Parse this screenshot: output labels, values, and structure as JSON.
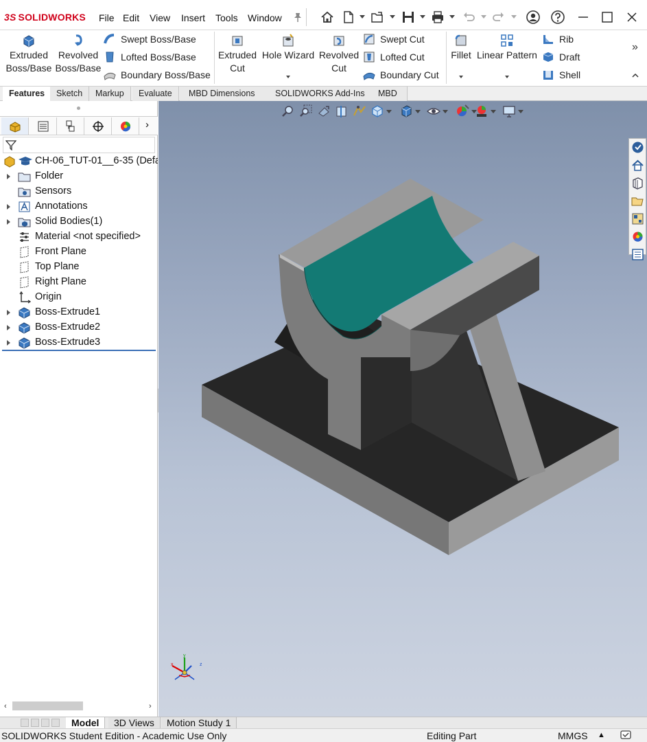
{
  "app": {
    "brand": "SOLIDWORKS",
    "brand_prefix": "3S"
  },
  "menu": [
    "File",
    "Edit",
    "View",
    "Insert",
    "Tools",
    "Window"
  ],
  "window_controls": {
    "minimize": "minimize-icon",
    "maximize": "maximize-icon",
    "close": "close-icon"
  },
  "ribbon": {
    "extruded_boss": [
      "Extruded",
      "Boss/Base"
    ],
    "revolved_boss": [
      "Revolved",
      "Boss/Base"
    ],
    "swept_boss": "Swept Boss/Base",
    "lofted_boss": "Lofted Boss/Base",
    "boundary_boss": "Boundary Boss/Base",
    "extruded_cut": [
      "Extruded",
      "Cut"
    ],
    "hole_wizard": "Hole Wizard",
    "revolved_cut": [
      "Revolved",
      "Cut"
    ],
    "swept_cut": "Swept Cut",
    "lofted_cut": "Lofted Cut",
    "boundary_cut": "Boundary Cut",
    "fillet": "Fillet",
    "linear_pattern": "Linear Pattern",
    "rib": "Rib",
    "draft": "Draft",
    "shell": "Shell"
  },
  "tabs": [
    "Features",
    "Sketch",
    "Markup",
    "Evaluate",
    "MBD Dimensions",
    "SOLIDWORKS Add-Ins",
    "MBD"
  ],
  "tree": {
    "root": "CH-06_TUT-01__6-35 (Defa",
    "items": [
      {
        "label": "Folder",
        "icon": "folder-icon",
        "expandable": true
      },
      {
        "label": "Sensors",
        "icon": "sensors-icon",
        "expandable": false
      },
      {
        "label": "Annotations",
        "icon": "annotations-icon",
        "expandable": true
      },
      {
        "label": "Solid Bodies(1)",
        "icon": "solid-bodies-icon",
        "expandable": true
      },
      {
        "label": "Material <not specified>",
        "icon": "material-icon",
        "expandable": false
      },
      {
        "label": "Front Plane",
        "icon": "plane-icon",
        "expandable": false
      },
      {
        "label": "Top Plane",
        "icon": "plane-icon",
        "expandable": false
      },
      {
        "label": "Right Plane",
        "icon": "plane-icon",
        "expandable": false
      },
      {
        "label": "Origin",
        "icon": "origin-icon",
        "expandable": false
      },
      {
        "label": "Boss-Extrude1",
        "icon": "extrude-feature-icon",
        "expandable": true
      },
      {
        "label": "Boss-Extrude2",
        "icon": "extrude-feature-icon",
        "expandable": true
      },
      {
        "label": "Boss-Extrude3",
        "icon": "extrude-feature-icon",
        "expandable": true
      }
    ]
  },
  "bottom_tabs": [
    "Model",
    "3D Views",
    "Motion Study 1"
  ],
  "status": {
    "edition": "SOLIDWORKS Student Edition - Academic Use Only",
    "mode": "Editing Part",
    "units": "MMGS"
  },
  "triad": {
    "x": "x",
    "y": "y",
    "z": "z"
  },
  "colors": {
    "brand": "#d0021b",
    "viewport_top": "#7f90aa",
    "viewport_bottom": "#cdd4e1",
    "part_face_light": "#8a8a8a",
    "part_face_dark": "#2a2a2a",
    "cylindrical_face": "#137a74",
    "selection_line": "#3b6fb6"
  }
}
